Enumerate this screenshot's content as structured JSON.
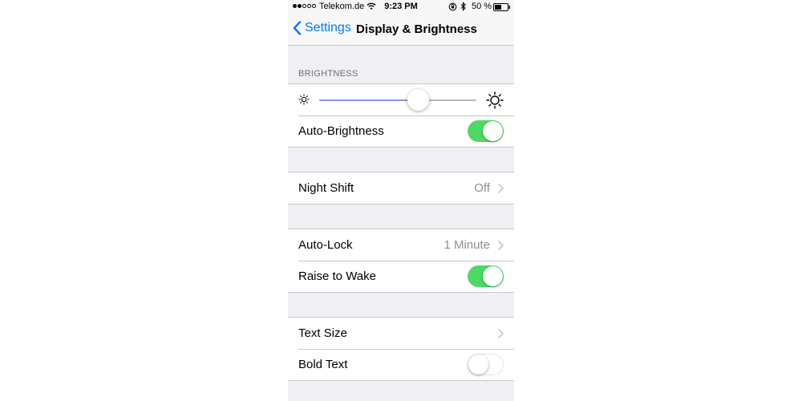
{
  "status_bar": {
    "carrier": "Telekom.de",
    "time": "9:23 PM",
    "battery": "50 %"
  },
  "nav": {
    "back_label": "Settings",
    "title": "Display & Brightness"
  },
  "brightness": {
    "header": "BRIGHTNESS",
    "level": 0.63,
    "auto_label": "Auto-Brightness",
    "auto_on": true
  },
  "night_shift": {
    "label": "Night Shift",
    "value": "Off"
  },
  "lock": {
    "auto_lock_label": "Auto-Lock",
    "auto_lock_value": "1 Minute",
    "raise_label": "Raise to Wake",
    "raise_on": true
  },
  "text": {
    "size_label": "Text Size",
    "bold_label": "Bold Text",
    "bold_on": false
  },
  "colors": {
    "accent": "#007aff",
    "toggle_on": "#4cd964",
    "background": "#efeff4"
  },
  "icons": [
    "wifi-icon",
    "orientation-lock-icon",
    "bluetooth-icon",
    "battery-icon",
    "back-chevron-icon",
    "sun-small-icon",
    "sun-large-icon",
    "chevron-right-icon"
  ]
}
